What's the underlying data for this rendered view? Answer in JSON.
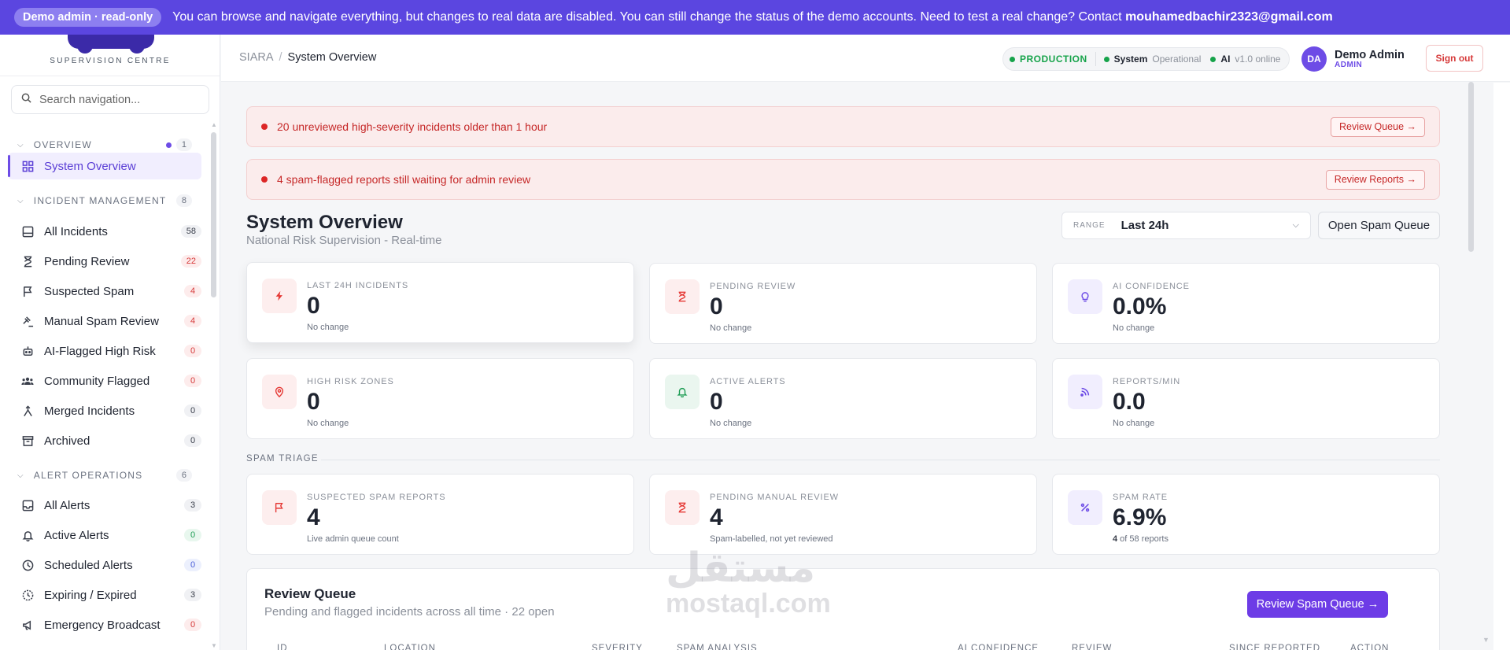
{
  "banner": {
    "pill": "Demo admin · read-only",
    "message": "You can browse and navigate everything, but changes to real data are disabled. You can still change the status of the demo accounts.  Need to test a real change? Contact ",
    "email": "mouhamedbachir2323@gmail.com"
  },
  "sidebar": {
    "logo_subtitle": "SUPERVISION CENTRE",
    "search_placeholder": "Search navigation...",
    "sections": [
      {
        "label": "OVERVIEW",
        "count": "1"
      },
      {
        "label": "INCIDENT MANAGEMENT",
        "count": "8"
      },
      {
        "label": "ALERT OPERATIONS",
        "count": "6"
      }
    ],
    "overview_items": [
      {
        "label": "System Overview",
        "icon": "grid-icon"
      }
    ],
    "incident_items": [
      {
        "label": "All Incidents",
        "count": "58",
        "icon": "list-icon"
      },
      {
        "label": "Pending Review",
        "count": "22",
        "icon": "hourglass-icon"
      },
      {
        "label": "Suspected Spam",
        "count": "4",
        "icon": "flag-icon"
      },
      {
        "label": "Manual Spam Review",
        "count": "4",
        "icon": "gavel-icon"
      },
      {
        "label": "AI-Flagged High Risk",
        "count": "0",
        "icon": "robot-icon"
      },
      {
        "label": "Community Flagged",
        "count": "0",
        "icon": "users-icon"
      },
      {
        "label": "Merged Incidents",
        "count": "0",
        "icon": "merge-icon"
      },
      {
        "label": "Archived",
        "count": "0",
        "icon": "archive-icon"
      }
    ],
    "alert_items": [
      {
        "label": "All Alerts",
        "count": "3",
        "icon": "inbox-icon"
      },
      {
        "label": "Active Alerts",
        "count": "0",
        "icon": "bell-icon"
      },
      {
        "label": "Scheduled Alerts",
        "count": "0",
        "icon": "clock-icon"
      },
      {
        "label": "Expiring / Expired",
        "count": "3",
        "icon": "timer-icon"
      },
      {
        "label": "Emergency Broadcast",
        "count": "0",
        "icon": "megaphone-icon"
      }
    ]
  },
  "header": {
    "breadcrumb_root": "SIARA",
    "breadcrumb_sep": "/",
    "breadcrumb_current": "System Overview",
    "env": "PRODUCTION",
    "system_label": "System",
    "system_status": "Operational",
    "ai_label": "AI",
    "ai_status": "v1.0 online",
    "user_initials": "DA",
    "user_name": "Demo Admin",
    "user_role": "ADMIN",
    "signout": "Sign out"
  },
  "alerts": [
    {
      "text": "20 unreviewed high-severity incidents older than 1 hour",
      "action": "Review Queue →"
    },
    {
      "text": "4 spam-flagged reports still waiting for admin review",
      "action": "Review Reports →"
    }
  ],
  "page": {
    "title": "System Overview",
    "subtitle": "National Risk Supervision - Real-time",
    "range_label": "RANGE",
    "range_value": "Last 24h",
    "open_spam_queue": "Open Spam Queue"
  },
  "stats": [
    {
      "label": "LAST 24H INCIDENTS",
      "value": "0",
      "note": "No change",
      "icon": "bolt-icon"
    },
    {
      "label": "PENDING REVIEW",
      "value": "0",
      "note": "No change",
      "icon": "hourglass-icon"
    },
    {
      "label": "AI CONFIDENCE",
      "value": "0.0%",
      "note": "No change",
      "icon": "bulb-icon"
    },
    {
      "label": "HIGH RISK ZONES",
      "value": "0",
      "note": "No change",
      "icon": "pin-icon"
    },
    {
      "label": "ACTIVE ALERTS",
      "value": "0",
      "note": "No change",
      "icon": "bell-icon"
    },
    {
      "label": "REPORTS/MIN",
      "value": "0.0",
      "note": "No change",
      "icon": "feed-icon"
    }
  ],
  "triage": {
    "heading": "SPAM TRIAGE",
    "cards": [
      {
        "label": "SUSPECTED SPAM REPORTS",
        "value": "4",
        "note": "Live admin queue count",
        "icon": "flag-icon"
      },
      {
        "label": "PENDING MANUAL REVIEW",
        "value": "4",
        "note": "Spam-labelled, not yet reviewed",
        "icon": "hourglass-icon"
      },
      {
        "label": "SPAM RATE",
        "value": "6.9%",
        "note_strong": "4",
        "note": " of 58 reports",
        "icon": "percent-icon"
      }
    ]
  },
  "queue": {
    "title": "Review Queue",
    "subtitle": "Pending and flagged incidents across all time · 22 open",
    "button": "Review Spam Queue →",
    "columns": [
      "ID",
      "LOCATION",
      "SEVERITY",
      "SPAM ANALYSIS",
      "AI CONFIDENCE",
      "REVIEW",
      "SINCE REPORTED",
      "ACTION"
    ]
  },
  "watermark": {
    "arabic": "مستقل",
    "latin": "mostaql.com"
  }
}
